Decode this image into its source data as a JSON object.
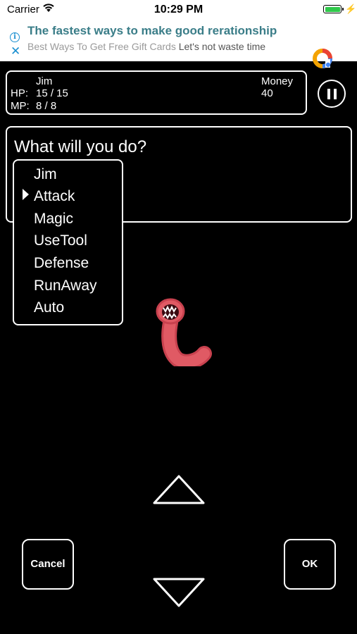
{
  "status_bar": {
    "carrier": "Carrier",
    "time": "10:29 PM"
  },
  "ad": {
    "title": "The fastest ways to make good rerationship",
    "subtitle_grey": "Best Ways To Get Free Gift Cards",
    "subtitle_dark": "Let's not waste time",
    "info_glyph": "i",
    "close_glyph": "✕"
  },
  "hud": {
    "name": "Jim",
    "hp_label": "HP:",
    "hp_value": "15 / 15",
    "mp_label": "MP:",
    "mp_value": "8 / 8",
    "money_label": "Money",
    "money_value": "40"
  },
  "message": "What will you do?",
  "menu": {
    "items": [
      "Jim",
      "Attack",
      "Magic",
      "UseTool",
      "Defense",
      "RunAway",
      "Auto"
    ],
    "selected": "Attack"
  },
  "buttons": {
    "cancel": "Cancel",
    "ok": "OK"
  },
  "colors": {
    "ad_title": "#3a7d88",
    "ad_icon": "#1a8fd0",
    "battery": "#2fc94a",
    "monster": "#e05a64"
  }
}
